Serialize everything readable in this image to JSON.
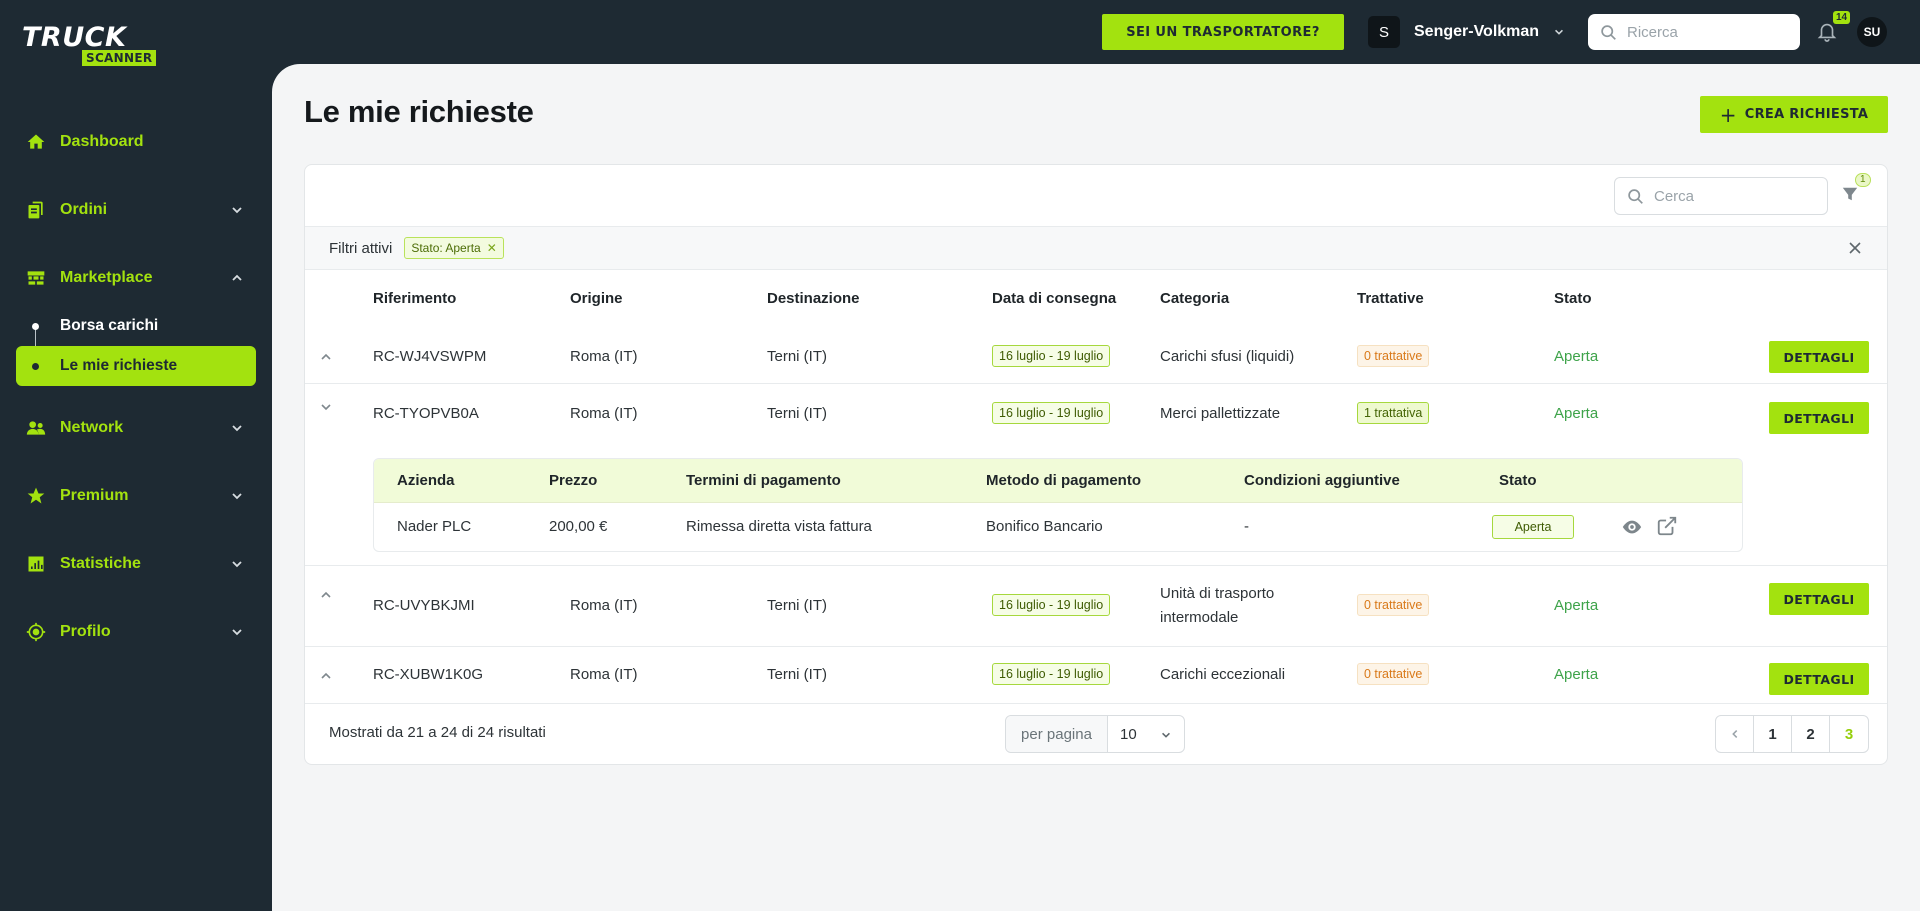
{
  "brand": {
    "line1": "TRUCK",
    "line2": "SCANNER",
    "accent": "#a3e20f",
    "dark": "#1e2a33"
  },
  "sidebar": {
    "items": [
      {
        "label": "Dashboard",
        "icon": "home-icon"
      },
      {
        "label": "Ordini",
        "icon": "documents-icon"
      },
      {
        "label": "Marketplace",
        "icon": "warehouse-icon"
      },
      {
        "label": "Network",
        "icon": "users-icon"
      },
      {
        "label": "Premium",
        "icon": "star-icon"
      },
      {
        "label": "Statistiche",
        "icon": "chart-icon"
      },
      {
        "label": "Profilo",
        "icon": "settings-icon"
      }
    ],
    "sub": [
      {
        "label": "Borsa carichi"
      },
      {
        "label": "Le mie richieste"
      }
    ]
  },
  "header": {
    "cta": "SEI UN TRASPORTATORE?",
    "company_initial": "S",
    "company": "Senger-Volkman",
    "search_placeholder": "Ricerca",
    "notifications": "14",
    "user_initials": "SU"
  },
  "page": {
    "title": "Le mie richieste",
    "create_label": "CREA RICHIESTA",
    "search_placeholder": "Cerca",
    "filter_count": "1",
    "filters_label": "Filtri attivi",
    "filter_chip": "Stato: Aperta",
    "columns": [
      "Riferimento",
      "Origine",
      "Destinazione",
      "Data di consegna",
      "Categoria",
      "Trattative",
      "Stato"
    ],
    "rows": [
      {
        "ref": "RC-WJ4VSWPM",
        "origin": "Roma (IT)",
        "dest": "Terni (IT)",
        "date": "16 luglio - 19 luglio",
        "category": "Carichi sfusi (liquidi)",
        "category2": "",
        "neg": "0 trattative",
        "status": "Aperta",
        "action": "DETTAGLI"
      },
      {
        "ref": "RC-TYOPVB0A",
        "origin": "Roma (IT)",
        "dest": "Terni (IT)",
        "date": "16 luglio - 19 luglio",
        "category": "Merci pallettizzate",
        "category2": "",
        "neg": "1 trattativa",
        "status": "Aperta",
        "action": "DETTAGLI"
      },
      {
        "ref": "RC-UVYBKJMI",
        "origin": "Roma (IT)",
        "dest": "Terni (IT)",
        "date": "16 luglio - 19 luglio",
        "category": "Unità di trasporto",
        "category2": "intermodale",
        "neg": "0 trattative",
        "status": "Aperta",
        "action": "DETTAGLI"
      },
      {
        "ref": "RC-XUBW1K0G",
        "origin": "Roma (IT)",
        "dest": "Terni (IT)",
        "date": "16 luglio - 19 luglio",
        "category": "Carichi eccezionali",
        "category2": "",
        "neg": "0 trattative",
        "status": "Aperta",
        "action": "DETTAGLI"
      }
    ],
    "offers": {
      "columns": [
        "Azienda",
        "Prezzo",
        "Termini di pagamento",
        "Metodo di pagamento",
        "Condizioni aggiuntive",
        "Stato"
      ],
      "row": {
        "company": "Nader PLC",
        "price": "200,00 €",
        "terms": "Rimessa diretta vista fattura",
        "method": "Bonifico Bancario",
        "conditions": "-",
        "status": "Aperta"
      }
    },
    "footer": {
      "results": "Mostrati da 21 a 24 di 24 risultati",
      "per_page_label": "per pagina",
      "per_page_value": "10",
      "pages": [
        "1",
        "2",
        "3"
      ],
      "current_page": "3"
    }
  }
}
